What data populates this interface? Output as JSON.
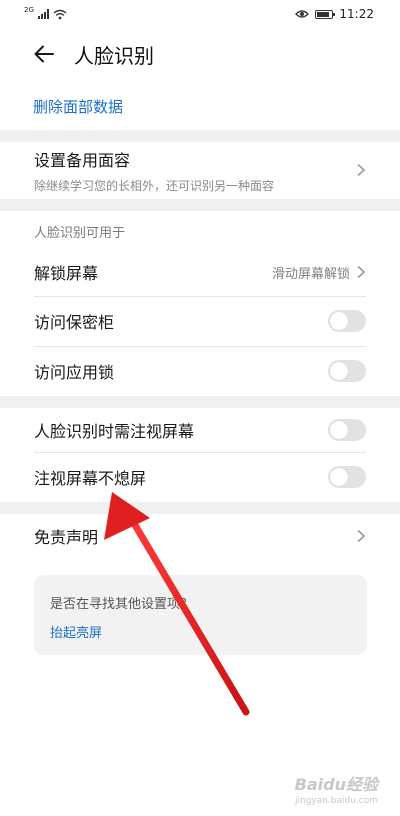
{
  "status_bar": {
    "net": "2G",
    "time": "11:22",
    "battery_percent": 85
  },
  "header": {
    "title": "人脸识别"
  },
  "delete_link": "删除面部数据",
  "alt_appearance": {
    "title": "设置备用面容",
    "subtitle": "除继续学习您的长相外，还可识别另一种面容"
  },
  "section_header": "人脸识别可用于",
  "unlock": {
    "label": "解锁屏幕",
    "value": "滑动屏幕解锁"
  },
  "safe_box": {
    "label": "访问保密柜",
    "on": false
  },
  "app_lock": {
    "label": "访问应用锁",
    "on": false
  },
  "require_gaze": {
    "label": "人脸识别时需注视屏幕",
    "on": false
  },
  "gaze_keep_on": {
    "label": "注视屏幕不熄屏",
    "on": false
  },
  "disclaimer": {
    "label": "免责声明"
  },
  "suggest": {
    "title": "是否在寻找其他设置项？",
    "link": "抬起亮屏"
  },
  "watermark": {
    "brand": "Baidu经验",
    "url": "jingyan.baidu.com"
  },
  "colors": {
    "accent": "#1a6fc9",
    "arrow": "#e02020",
    "band": "#f0f0f0"
  }
}
